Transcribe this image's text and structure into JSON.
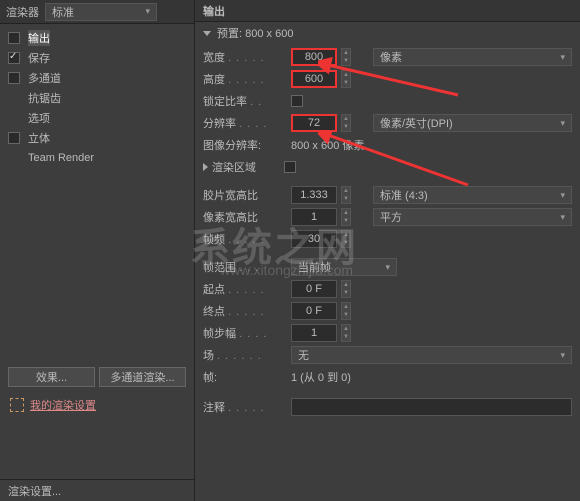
{
  "left": {
    "renderer_label": "渲染器",
    "renderer_value": "标准",
    "items": [
      {
        "label": "输出",
        "checked": false,
        "hl": true
      },
      {
        "label": "保存",
        "checked": true
      },
      {
        "label": "多通道",
        "checked": false
      },
      {
        "label": "抗锯齿",
        "checked": false
      },
      {
        "label": "选项",
        "checked": false
      },
      {
        "label": "立体",
        "checked": false
      },
      {
        "label": "Team Render",
        "checked": false
      }
    ],
    "fx_btn": "效果...",
    "multi_btn": "多通道渲染...",
    "my_settings": "我的渲染设置",
    "footer": "渲染设置..."
  },
  "right": {
    "title": "输出",
    "preset_label": "预置: 800 x 600",
    "width_label": "宽度",
    "width_value": "800",
    "width_unit": "像素",
    "height_label": "高度",
    "height_value": "600",
    "lock_label": "锁定比率",
    "res_label": "分辨率",
    "res_value": "72",
    "res_unit": "像素/英寸(DPI)",
    "img_res_label": "图像分辨率:",
    "img_res_value": "800 x 600 像素",
    "render_region": "渲染区域",
    "film_label": "胶片宽高比",
    "film_value": "1.333",
    "film_unit": "标准 (4:3)",
    "pixel_label": "像素宽高比",
    "pixel_value": "1",
    "pixel_unit": "平方",
    "fps_label": "帧频",
    "fps_value": "30",
    "range_label": "帧范围",
    "range_value": "当前帧",
    "start_label": "起点",
    "start_value": "0 F",
    "end_label": "终点",
    "end_value": "0 F",
    "step_label": "帧步幅",
    "step_value": "1",
    "field_label": "场",
    "field_value": "无",
    "frames_label": "帧:",
    "frames_value": "1 (从 0 到 0)",
    "notes_label": "注释"
  },
  "wm1": "系统之网",
  "wm2": "www.xitongzhijia.com"
}
